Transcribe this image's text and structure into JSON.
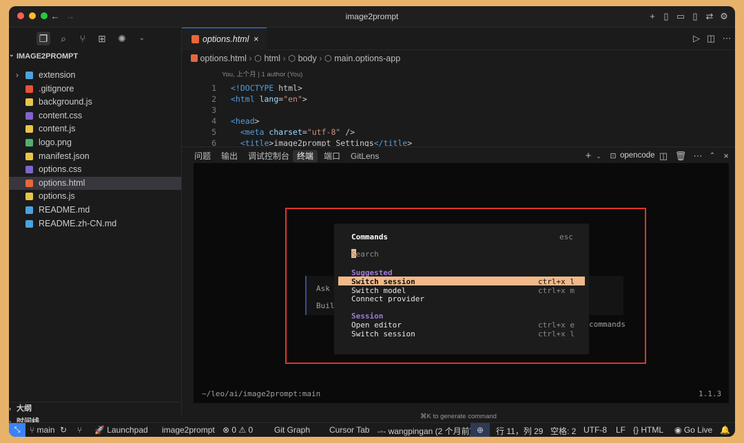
{
  "window": {
    "title": "image2prompt"
  },
  "sidebar": {
    "root": "IMAGE2PROMPT",
    "items": [
      {
        "label": "extension",
        "icon": "folder-icon",
        "color": "#4aa3df"
      },
      {
        "label": ".gitignore",
        "icon": "git-icon",
        "color": "#e5533c"
      },
      {
        "label": "background.js",
        "icon": "js-icon",
        "color": "#e7c547"
      },
      {
        "label": "content.css",
        "icon": "css-icon",
        "color": "#7f65c9"
      },
      {
        "label": "content.js",
        "icon": "js-icon",
        "color": "#e7c547"
      },
      {
        "label": "logo.png",
        "icon": "image-icon",
        "color": "#4fb16d"
      },
      {
        "label": "manifest.json",
        "icon": "json-icon",
        "color": "#e7c547"
      },
      {
        "label": "options.css",
        "icon": "css-icon",
        "color": "#7f65c9"
      },
      {
        "label": "options.html",
        "icon": "html-icon",
        "color": "#e5683c"
      },
      {
        "label": "options.js",
        "icon": "js-icon",
        "color": "#e7c547"
      },
      {
        "label": "README.md",
        "icon": "info-icon",
        "color": "#4aa3df"
      },
      {
        "label": "README.zh-CN.md",
        "icon": "markdown-icon",
        "color": "#4aa3df"
      }
    ],
    "outline": "大纲",
    "timeline": "时间线"
  },
  "editor": {
    "tab_label": "options.html",
    "breadcrumb": [
      "options.html",
      "html",
      "body",
      "main.options-app"
    ],
    "blame": "You, 上个月 | 1 author (You)",
    "lines": [
      {
        "n": "1",
        "text": "<!DOCTYPE html>"
      },
      {
        "n": "2",
        "text": "<html lang=\"en\">"
      },
      {
        "n": "3",
        "text": ""
      },
      {
        "n": "4",
        "text": "<head>"
      },
      {
        "n": "5",
        "text": "  <meta charset=\"utf-8\" />"
      },
      {
        "n": "6",
        "text": "  <title>image2prompt Settings</title>"
      }
    ]
  },
  "panel": {
    "tabs": [
      "问题",
      "输出",
      "调试控制台",
      "终端",
      "端口",
      "GitLens"
    ],
    "active_tab": "终端",
    "terminal_name": "opencode"
  },
  "terminal": {
    "bg_ask": "Ask",
    "bg_build": "Buil",
    "bg_commands": "commands",
    "prompt": "~/leo/ai/image2prompt:main",
    "version": "1.1.3",
    "hint": "⌘K to generate command"
  },
  "commands_dialog": {
    "title": "Commands",
    "esc": "esc",
    "search_placeholder": "Search",
    "sections": [
      {
        "name": "Suggested",
        "items": [
          {
            "label": "Switch session",
            "shortcut": "ctrl+x l",
            "selected": true
          },
          {
            "label": "Switch model",
            "shortcut": "ctrl+x m",
            "selected": false
          },
          {
            "label": "Connect provider",
            "shortcut": "",
            "selected": false
          }
        ]
      },
      {
        "name": "Session",
        "items": [
          {
            "label": "Open editor",
            "shortcut": "ctrl+x e",
            "selected": false
          },
          {
            "label": "Switch session",
            "shortcut": "ctrl+x l",
            "selected": false
          }
        ]
      }
    ]
  },
  "status_bar": {
    "branch": "main",
    "launchpad": "Launchpad",
    "repo": "image2prompt",
    "problems": "0",
    "warnings": "0",
    "git_graph": "Git Graph",
    "cursor_tab": "Cursor Tab",
    "author": "wangpingan (2 个月前)",
    "position": "行 11，列 29",
    "spaces": "空格: 2",
    "encoding": "UTF-8",
    "eol": "LF",
    "language": "HTML",
    "golive": "Go Live"
  },
  "colors": {
    "accent": "#3b82f6",
    "highlight": "#f1b98a",
    "section": "#9d7cd8",
    "redbox": "#e0352b"
  }
}
